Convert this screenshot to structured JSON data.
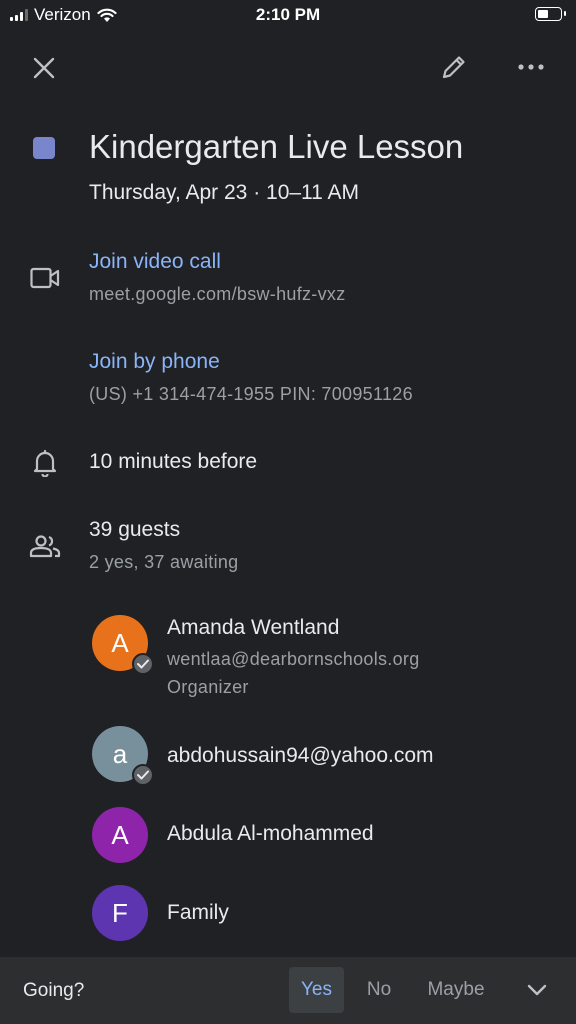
{
  "status_bar": {
    "carrier": "Verizon",
    "time": "2:10 PM"
  },
  "toolbar": {
    "close_icon": "close-icon",
    "edit_icon": "pencil-icon",
    "more_icon": "more-horizontal-icon"
  },
  "event": {
    "color": "#7986cb",
    "title": "Kindergarten Live Lesson",
    "datetime": "Thursday, Apr 23 · 10–11 AM"
  },
  "video": {
    "label": "Join video call",
    "url": "meet.google.com/bsw-hufz-vxz"
  },
  "phone": {
    "label": "Join by phone",
    "details": "(US) +1 314-474-1955 PIN: 700951126"
  },
  "notification": {
    "text": "10 minutes before"
  },
  "guests": {
    "count_label": "39 guests",
    "summary": "2 yes, 37 awaiting",
    "list": [
      {
        "initial": "A",
        "name": "Amanda Wentland",
        "email": "wentlaa@dearbornschools.org",
        "role": "Organizer",
        "color": "#e8711c",
        "accepted": true
      },
      {
        "initial": "a",
        "name": "abdohussain94@yahoo.com",
        "color": "#78909c",
        "accepted": true
      },
      {
        "initial": "A",
        "name": "Abdula Al-mohammed",
        "color": "#8e24aa",
        "accepted": false
      },
      {
        "initial": "F",
        "name": "Family",
        "color": "#5e35b1",
        "accepted": false
      }
    ]
  },
  "rsvp": {
    "label": "Going?",
    "yes": "Yes",
    "no": "No",
    "maybe": "Maybe",
    "selected": "Yes"
  }
}
